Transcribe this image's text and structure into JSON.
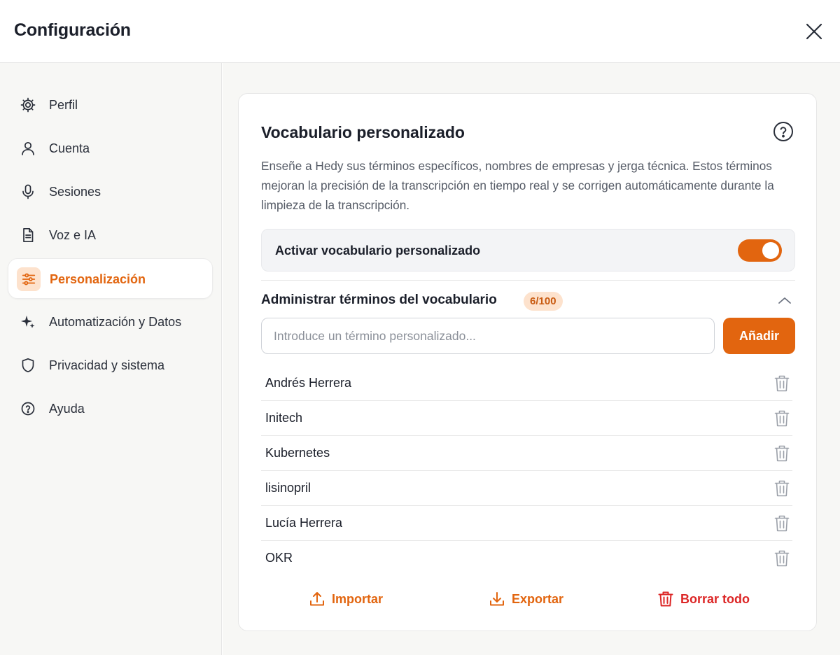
{
  "header": {
    "title": "Configuración"
  },
  "sidebar": {
    "items": [
      {
        "label": "Perfil",
        "icon": "gear-icon"
      },
      {
        "label": "Cuenta",
        "icon": "user-icon"
      },
      {
        "label": "Sesiones",
        "icon": "microphone-icon"
      },
      {
        "label": "Voz e IA",
        "icon": "document-icon"
      },
      {
        "label": "Personalización",
        "icon": "sliders-icon",
        "active": true
      },
      {
        "label": "Automatización y Datos",
        "icon": "sparkles-icon"
      },
      {
        "label": "Privacidad y sistema",
        "icon": "shield-icon"
      },
      {
        "label": "Ayuda",
        "icon": "help-circle-icon"
      }
    ]
  },
  "main": {
    "card": {
      "title": "Vocabulario personalizado",
      "description": "Enseñe a Hedy sus términos específicos, nombres de empresas y jerga técnica. Estos términos mejoran la precisión de la transcripción en tiempo real y se corrigen automáticamente durante la limpieza de la transcripción.",
      "toggle": {
        "label": "Activar vocabulario personalizado",
        "on": true
      },
      "manage": {
        "title": "Administrar términos del vocabulario",
        "count": "6/100",
        "expanded": true
      },
      "input": {
        "placeholder": "Introduce un término personalizado...",
        "value": ""
      },
      "add_label": "Añadir",
      "terms": [
        "Andrés Herrera",
        "Initech",
        "Kubernetes",
        "lisinopril",
        "Lucía Herrera",
        "OKR"
      ],
      "actions": {
        "import_label": "Importar",
        "export_label": "Exportar",
        "clear_label": "Borrar todo"
      }
    }
  },
  "colors": {
    "accent": "#e2650f",
    "accent_soft": "#fde2cd",
    "danger": "#dc2626",
    "sidebar_bg": "#f7f7f5"
  }
}
